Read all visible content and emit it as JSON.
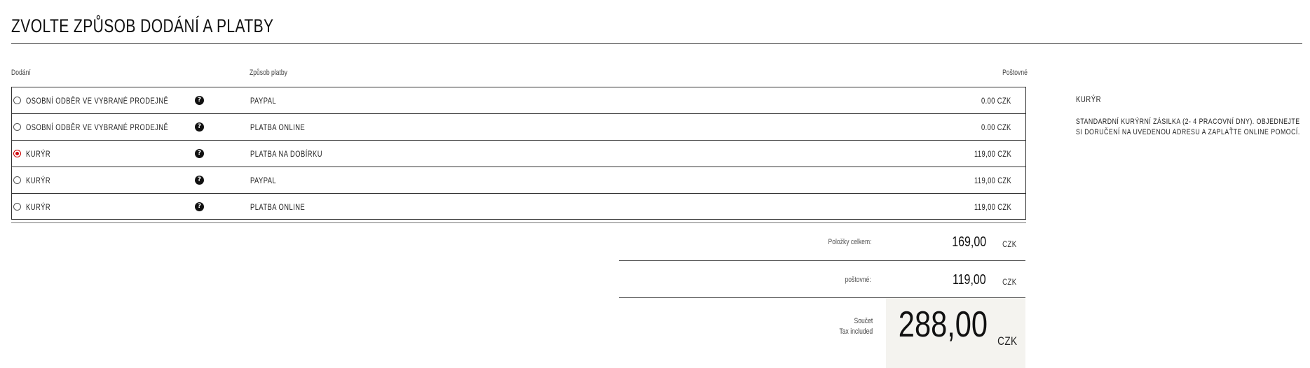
{
  "page": {
    "title": "ZVOLTE ZPŮSOB DODÁNÍ A PLATBY"
  },
  "columns": {
    "delivery": "Dodání",
    "payment": "Způsob platby",
    "shipping": "Poštovné"
  },
  "options": [
    {
      "delivery": "OSOBNÍ ODBĚR VE VYBRANÉ PRODEJNĚ",
      "payment": "PAYPAL",
      "price": "0.00 CZK",
      "selected": false
    },
    {
      "delivery": "OSOBNÍ ODBĚR VE VYBRANÉ PRODEJNĚ",
      "payment": "PLATBA ONLINE",
      "price": "0.00 CZK",
      "selected": false
    },
    {
      "delivery": "KURÝR",
      "payment": "PLATBA NA DOBÍRKU",
      "price": "119,00 CZK",
      "selected": true
    },
    {
      "delivery": "KURÝR",
      "payment": "PAYPAL",
      "price": "119,00 CZK",
      "selected": false
    },
    {
      "delivery": "KURÝR",
      "payment": "PLATBA ONLINE",
      "price": "119,00 CZK",
      "selected": false
    }
  ],
  "help_icon": "question-circle-icon",
  "side_panel": {
    "title": "KURÝR",
    "description": "STANDARDNÍ KURÝRNÍ ZÁSILKA (2- 4 PRACOVNÍ DNY). OBJEDNEJTE SI DORUČENÍ NA UVEDENOU ADRESU A ZAPLAŤTE ONLINE POMOCÍ."
  },
  "totals": {
    "items_label": "Položky celkem:",
    "items_value": "169,00",
    "shipping_label": "poštovné:",
    "shipping_value": "119,00",
    "currency": "CZK",
    "sum_label": "Součet",
    "tax_label": "Tax included",
    "sum_value": "288,00"
  },
  "colors": {
    "accent": "#d10a10",
    "total_bg": "#f4f3ef"
  }
}
